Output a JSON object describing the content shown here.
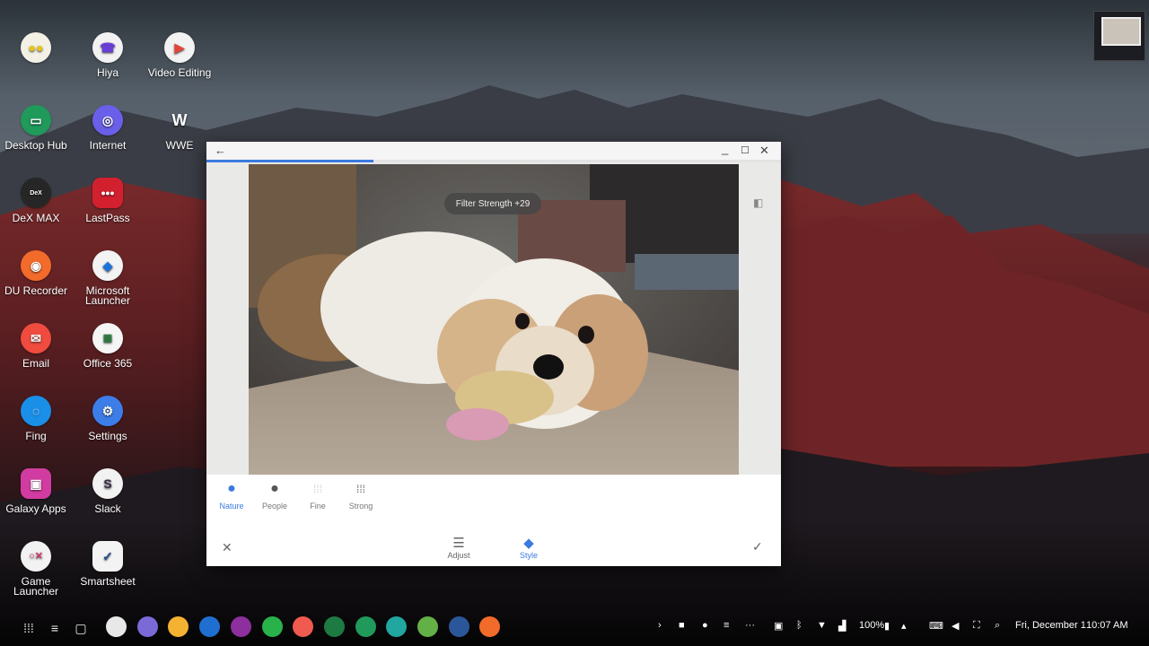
{
  "desktop": {
    "apps": [
      {
        "label": "",
        "icon": "yellow-dots-icon",
        "color": "#f3f1e5"
      },
      {
        "label": "Hiya",
        "icon": "phone-icon",
        "color": "#f2f2f2"
      },
      {
        "label": "Video Editing",
        "icon": "video-icon",
        "color": "#f2f2f2"
      },
      {
        "label": "Desktop Hub",
        "icon": "monitor-icon",
        "color": "#1f9a5b"
      },
      {
        "label": "Internet",
        "icon": "planet-icon",
        "color": "#6a5fe8"
      },
      {
        "label": "WWE",
        "icon": "wwe-logo-icon",
        "color": "#1a1a1a"
      },
      {
        "label": "DeX MAX",
        "icon": "dex-max-icon",
        "color": "#262626"
      },
      {
        "label": "LastPass",
        "icon": "dots-icon",
        "color": "#d3202f"
      },
      {
        "label": "DU Recorder",
        "icon": "record-icon",
        "color": "#f26b2a"
      },
      {
        "label": "Microsoft Launcher",
        "icon": "diamond-icon",
        "color": "#f3f3f3"
      },
      {
        "label": "Email",
        "icon": "envelope-icon",
        "color": "#ef4b3e"
      },
      {
        "label": "Office 365",
        "icon": "office-icon",
        "color": "#f5f5f5"
      },
      {
        "label": "Fing",
        "icon": "radar-icon",
        "color": "#1a8fe8"
      },
      {
        "label": "Settings",
        "icon": "gear-icon",
        "color": "#3d7de8"
      },
      {
        "label": "Galaxy Apps",
        "icon": "bag-icon",
        "color": "#d23ba1"
      },
      {
        "label": "Slack",
        "icon": "slack-icon",
        "color": "#f2f2f2"
      },
      {
        "label": "Game Launcher",
        "icon": "game-icon",
        "color": "#f2f2f2"
      },
      {
        "label": "Smartsheet",
        "icon": "check-icon",
        "color": "#f3f3f3"
      }
    ]
  },
  "window": {
    "progress": 0.29,
    "filter_strength_label": "Filter Strength +29",
    "styles": [
      {
        "label": "Nature",
        "icon": "nature-icon",
        "active": true
      },
      {
        "label": "People",
        "icon": "people-icon",
        "active": false
      },
      {
        "label": "Fine",
        "icon": "fine-grid-icon",
        "active": false
      },
      {
        "label": "Strong",
        "icon": "strong-grid-icon",
        "active": false
      }
    ],
    "bottom": {
      "adjust_label": "Adjust",
      "style_label": "Style"
    }
  },
  "taskbar": {
    "battery": "100%",
    "date": "Fri, December 1",
    "time": "10:07 AM",
    "dock_colors": [
      "#e8e8e8",
      "#7a6ad8",
      "#f4b233",
      "#1f6fd1",
      "#8d2f9e",
      "#29b24a",
      "#f05a4f",
      "#1d7a43",
      "#1f9a5b",
      "#21a6a0",
      "#62b046",
      "#2b579a",
      "#f26b2a"
    ]
  }
}
